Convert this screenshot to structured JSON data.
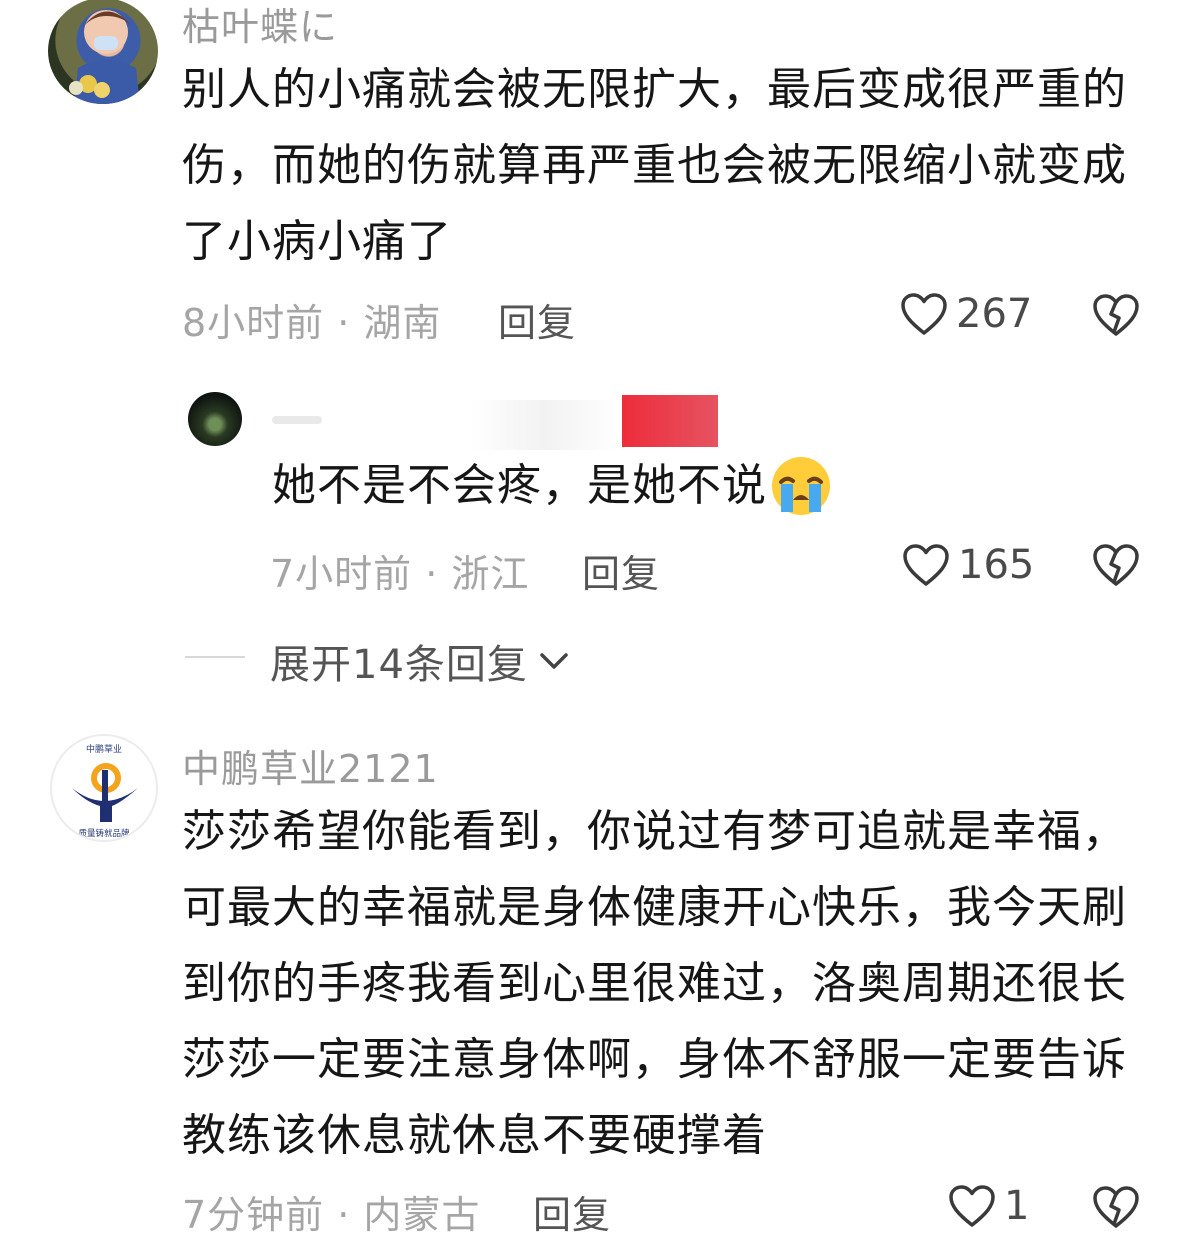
{
  "comments": [
    {
      "username": "枯叶蝶に",
      "lines": [
        "别人的小痛就会被无限扩大，最后变成很严重的",
        "伤，而她的伤就算再严重也会被无限缩小就变成",
        "了小病小痛了"
      ],
      "meta": "8小时前 · 湖南",
      "reply_label": "回复",
      "likes": "267"
    },
    {
      "username": "",
      "lines": [
        "她不是不会疼，是她不说"
      ],
      "meta": "7小时前 · 浙江",
      "reply_label": "回复",
      "likes": "165"
    },
    {
      "username": "中鹏草业2121",
      "lines": [
        "莎莎希望你能看到，你说过有梦可追就是幸福，",
        "可最大的幸福就是身体健康开心快乐，我今天刷",
        "到你的手疼我看到心里很难过，洛奥周期还很长",
        "莎莎一定要注意身体啊，身体不舒服一定要告诉",
        "教练该休息就休息不要硬撑着"
      ],
      "meta": "7分钟前 · 内蒙古",
      "reply_label": "回复",
      "likes": "1"
    }
  ],
  "expand_replies": "展开14条回复",
  "avatar_logo": {
    "top_text": "中鹏草业",
    "bottom_text": "质量铸就品牌"
  },
  "icons": {
    "like": "heart-outline-icon",
    "dislike": "broken-heart-icon",
    "expand": "chevron-down-icon",
    "emoji": "crying-face-emoji"
  },
  "colors": {
    "text": "#161616",
    "muted": "#a5a5a5",
    "redact": "#e8323c"
  }
}
